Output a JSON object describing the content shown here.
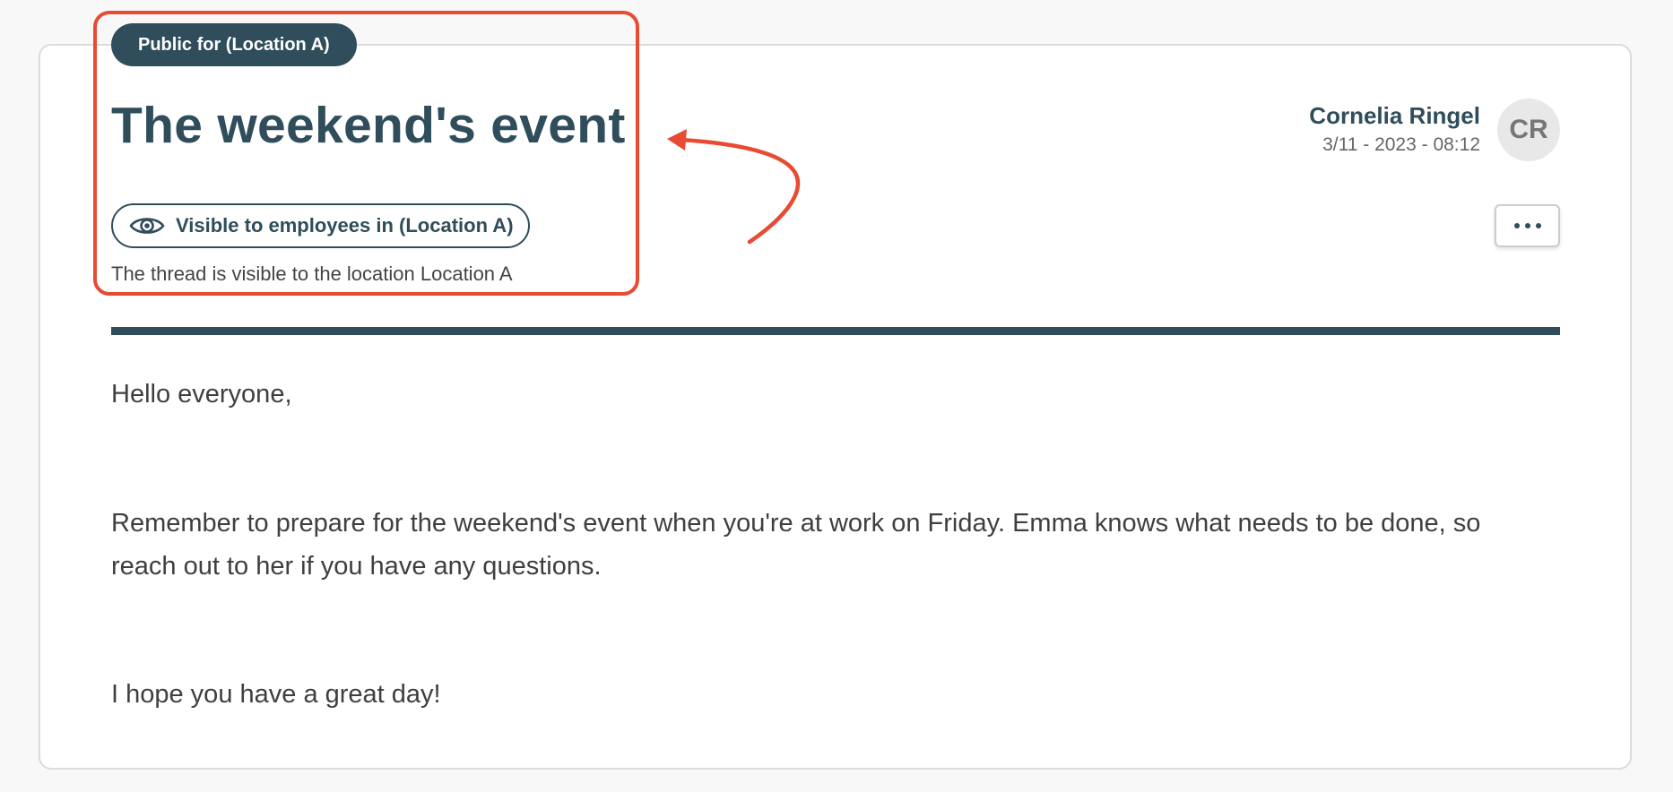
{
  "post": {
    "audience_badge": "Public for (Location A)",
    "title": "The weekend's event",
    "visibility_label": "Visible to employees in (Location A)",
    "visibility_note": "The thread is visible to the location Location A",
    "author": {
      "name": "Cornelia Ringel",
      "date": "3/11 - 2023 - 08:12",
      "initials": "CR"
    },
    "body": [
      "Hello everyone,",
      "Remember to prepare for the weekend's event when you're at work on Friday. Emma knows what needs to be done, so reach out to her if you have any questions.",
      "I hope you have a great day!"
    ]
  },
  "icons": {
    "visibility": "eye-icon",
    "more": "more-options-icon"
  },
  "colors": {
    "primary": "#2f4d5a",
    "annotation": "#e84a32",
    "avatar_bg": "#e8e8e8"
  }
}
